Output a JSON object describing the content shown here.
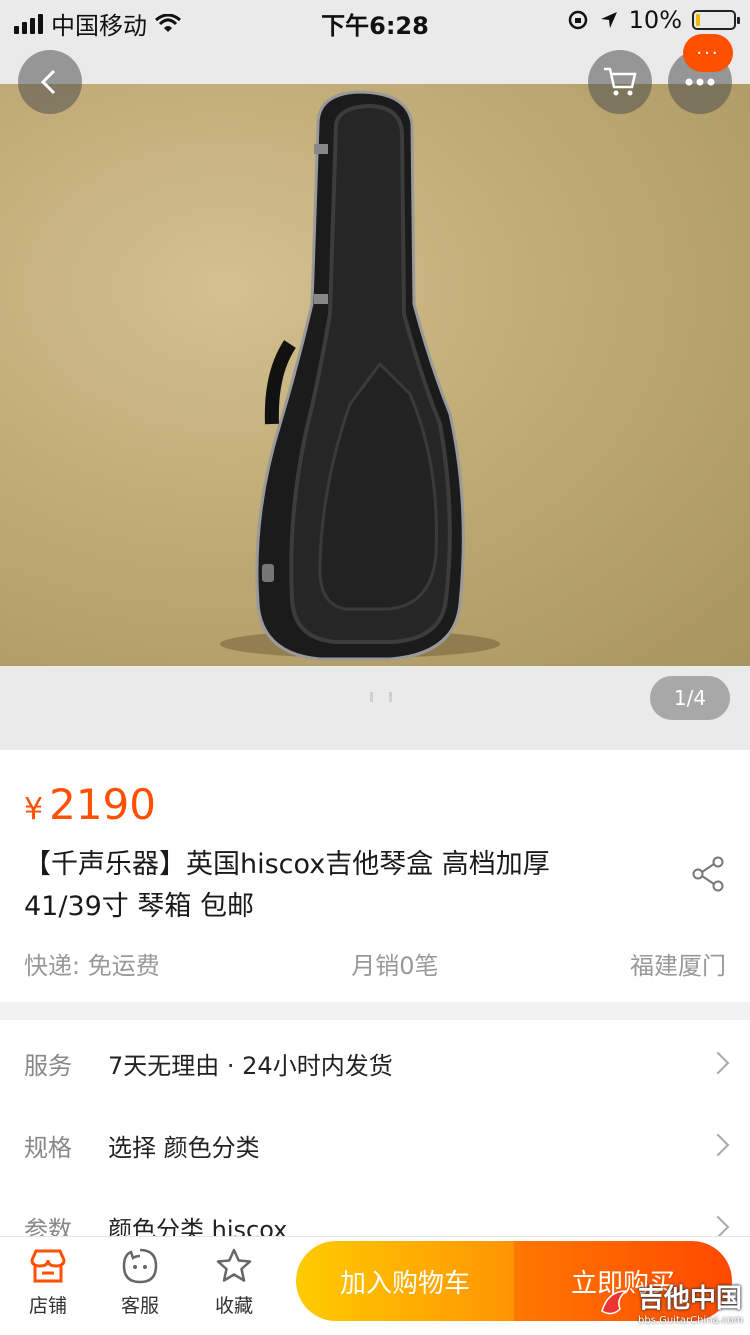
{
  "status_bar": {
    "carrier": "中国移动",
    "time": "下午6:28",
    "battery": "10%"
  },
  "gallery": {
    "counter": "1/4",
    "more_badge": "···"
  },
  "product": {
    "currency": "¥",
    "price": "2190",
    "title": "【千声乐器】英国hiscox吉他琴盒 高档加厚41/39寸 琴箱 包邮",
    "shipping": "快递: 免运费",
    "monthly_sales": "月销0笔",
    "location": "福建厦门"
  },
  "options": [
    {
      "key": "服务",
      "value": "7天无理由 · 24小时内发货"
    },
    {
      "key": "规格",
      "value": "选择  颜色分类"
    },
    {
      "key": "参数",
      "value": "颜色分类 hiscox"
    }
  ],
  "bottom_bar": {
    "shop": "店铺",
    "service": "客服",
    "favorite": "收藏",
    "add_to_cart": "加入购物车",
    "buy_now": "立即购买"
  },
  "watermark": {
    "title": "吉他中国",
    "url": "bbs.GuitarChina.com"
  },
  "colors": {
    "accent": "#ff5000",
    "cart_start": "#ffcb00",
    "cart_end": "#ff9402",
    "buy_start": "#ff7700",
    "buy_end": "#ff4900"
  },
  "icons": [
    "back-icon",
    "cart-icon",
    "more-icon",
    "share-icon",
    "shop-icon",
    "service-icon",
    "star-icon"
  ]
}
